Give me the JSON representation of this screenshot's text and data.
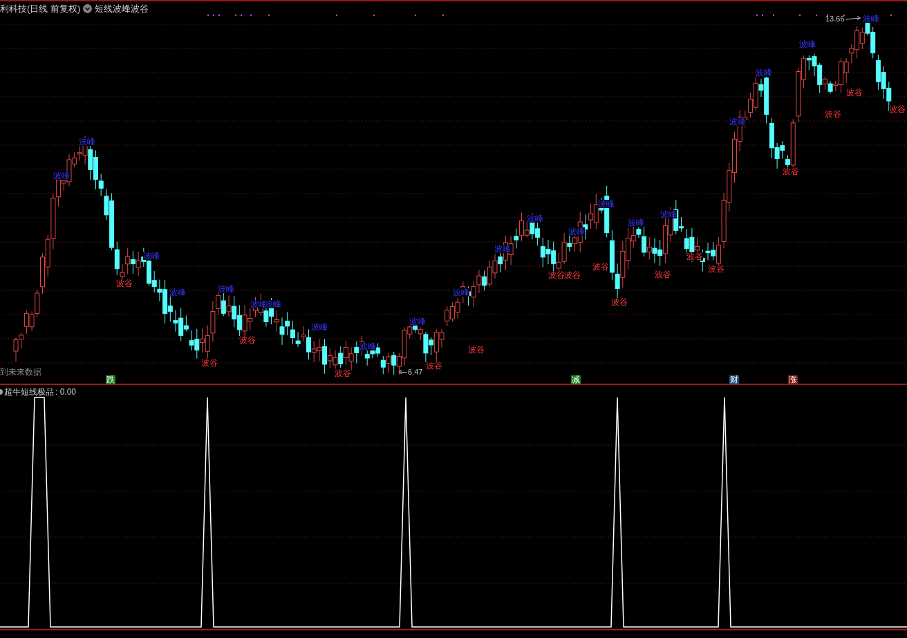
{
  "header": {
    "title": "利科技(日线 前复权)",
    "indicator": "短线波峰波谷"
  },
  "main_chart": {
    "labels": [
      {
        "kind": "peak",
        "text": "波峰"
      },
      {
        "kind": "peak",
        "text": "波峰"
      },
      {
        "kind": "trough",
        "text": "波谷"
      },
      {
        "kind": "peak",
        "text": "波峰"
      },
      {
        "kind": "peak",
        "text": "波峰"
      },
      {
        "kind": "trough",
        "text": "波谷"
      },
      {
        "kind": "peak",
        "text": "波峰"
      },
      {
        "kind": "trough",
        "text": "波谷"
      },
      {
        "kind": "peak",
        "text": "波峰"
      },
      {
        "kind": "peak",
        "text": "波峰"
      },
      {
        "kind": "peak",
        "text": "波峰"
      },
      {
        "kind": "trough",
        "text": "波谷"
      },
      {
        "kind": "peak",
        "text": "波峰"
      },
      {
        "kind": "peak",
        "text": "波峰"
      },
      {
        "kind": "trough",
        "text": "波谷"
      },
      {
        "kind": "peak",
        "text": "波峰"
      },
      {
        "kind": "trough",
        "text": "波谷"
      },
      {
        "kind": "peak",
        "text": "波峰"
      },
      {
        "kind": "peak",
        "text": "波峰"
      },
      {
        "kind": "trough",
        "text": "波谷"
      },
      {
        "kind": "trough",
        "text": "波谷"
      },
      {
        "kind": "peak",
        "text": "波峰"
      },
      {
        "kind": "trough",
        "text": "波谷"
      },
      {
        "kind": "peak",
        "text": "波峰"
      },
      {
        "kind": "trough",
        "text": "波谷"
      },
      {
        "kind": "peak",
        "text": "波峰"
      },
      {
        "kind": "trough",
        "text": "波谷"
      },
      {
        "kind": "peak",
        "text": "波峰"
      },
      {
        "kind": "trough",
        "text": "波谷"
      },
      {
        "kind": "trough",
        "text": "波谷"
      },
      {
        "kind": "peak",
        "text": "波峰"
      },
      {
        "kind": "peak",
        "text": "波峰"
      },
      {
        "kind": "trough",
        "text": "波谷"
      },
      {
        "kind": "peak",
        "text": "波峰"
      },
      {
        "kind": "trough",
        "text": "波谷"
      },
      {
        "kind": "trough",
        "text": "波谷"
      },
      {
        "kind": "peak",
        "text": "波峰"
      },
      {
        "kind": "trough",
        "text": "波谷"
      }
    ],
    "price_marks": [
      {
        "kind": "high",
        "text": "13.66"
      },
      {
        "kind": "low",
        "text": "6.47"
      }
    ],
    "note": "到未来数据",
    "signals": [
      {
        "text": "跌",
        "color": "#1e7d1e"
      },
      {
        "text": "减",
        "color": "#1e7d1e"
      },
      {
        "text": "财",
        "color": "#1f4f7a"
      },
      {
        "text": "涨",
        "color": "#7a1a1a"
      }
    ]
  },
  "sub_chart": {
    "title": "超牛短线极品",
    "value": ": 0.00"
  }
}
